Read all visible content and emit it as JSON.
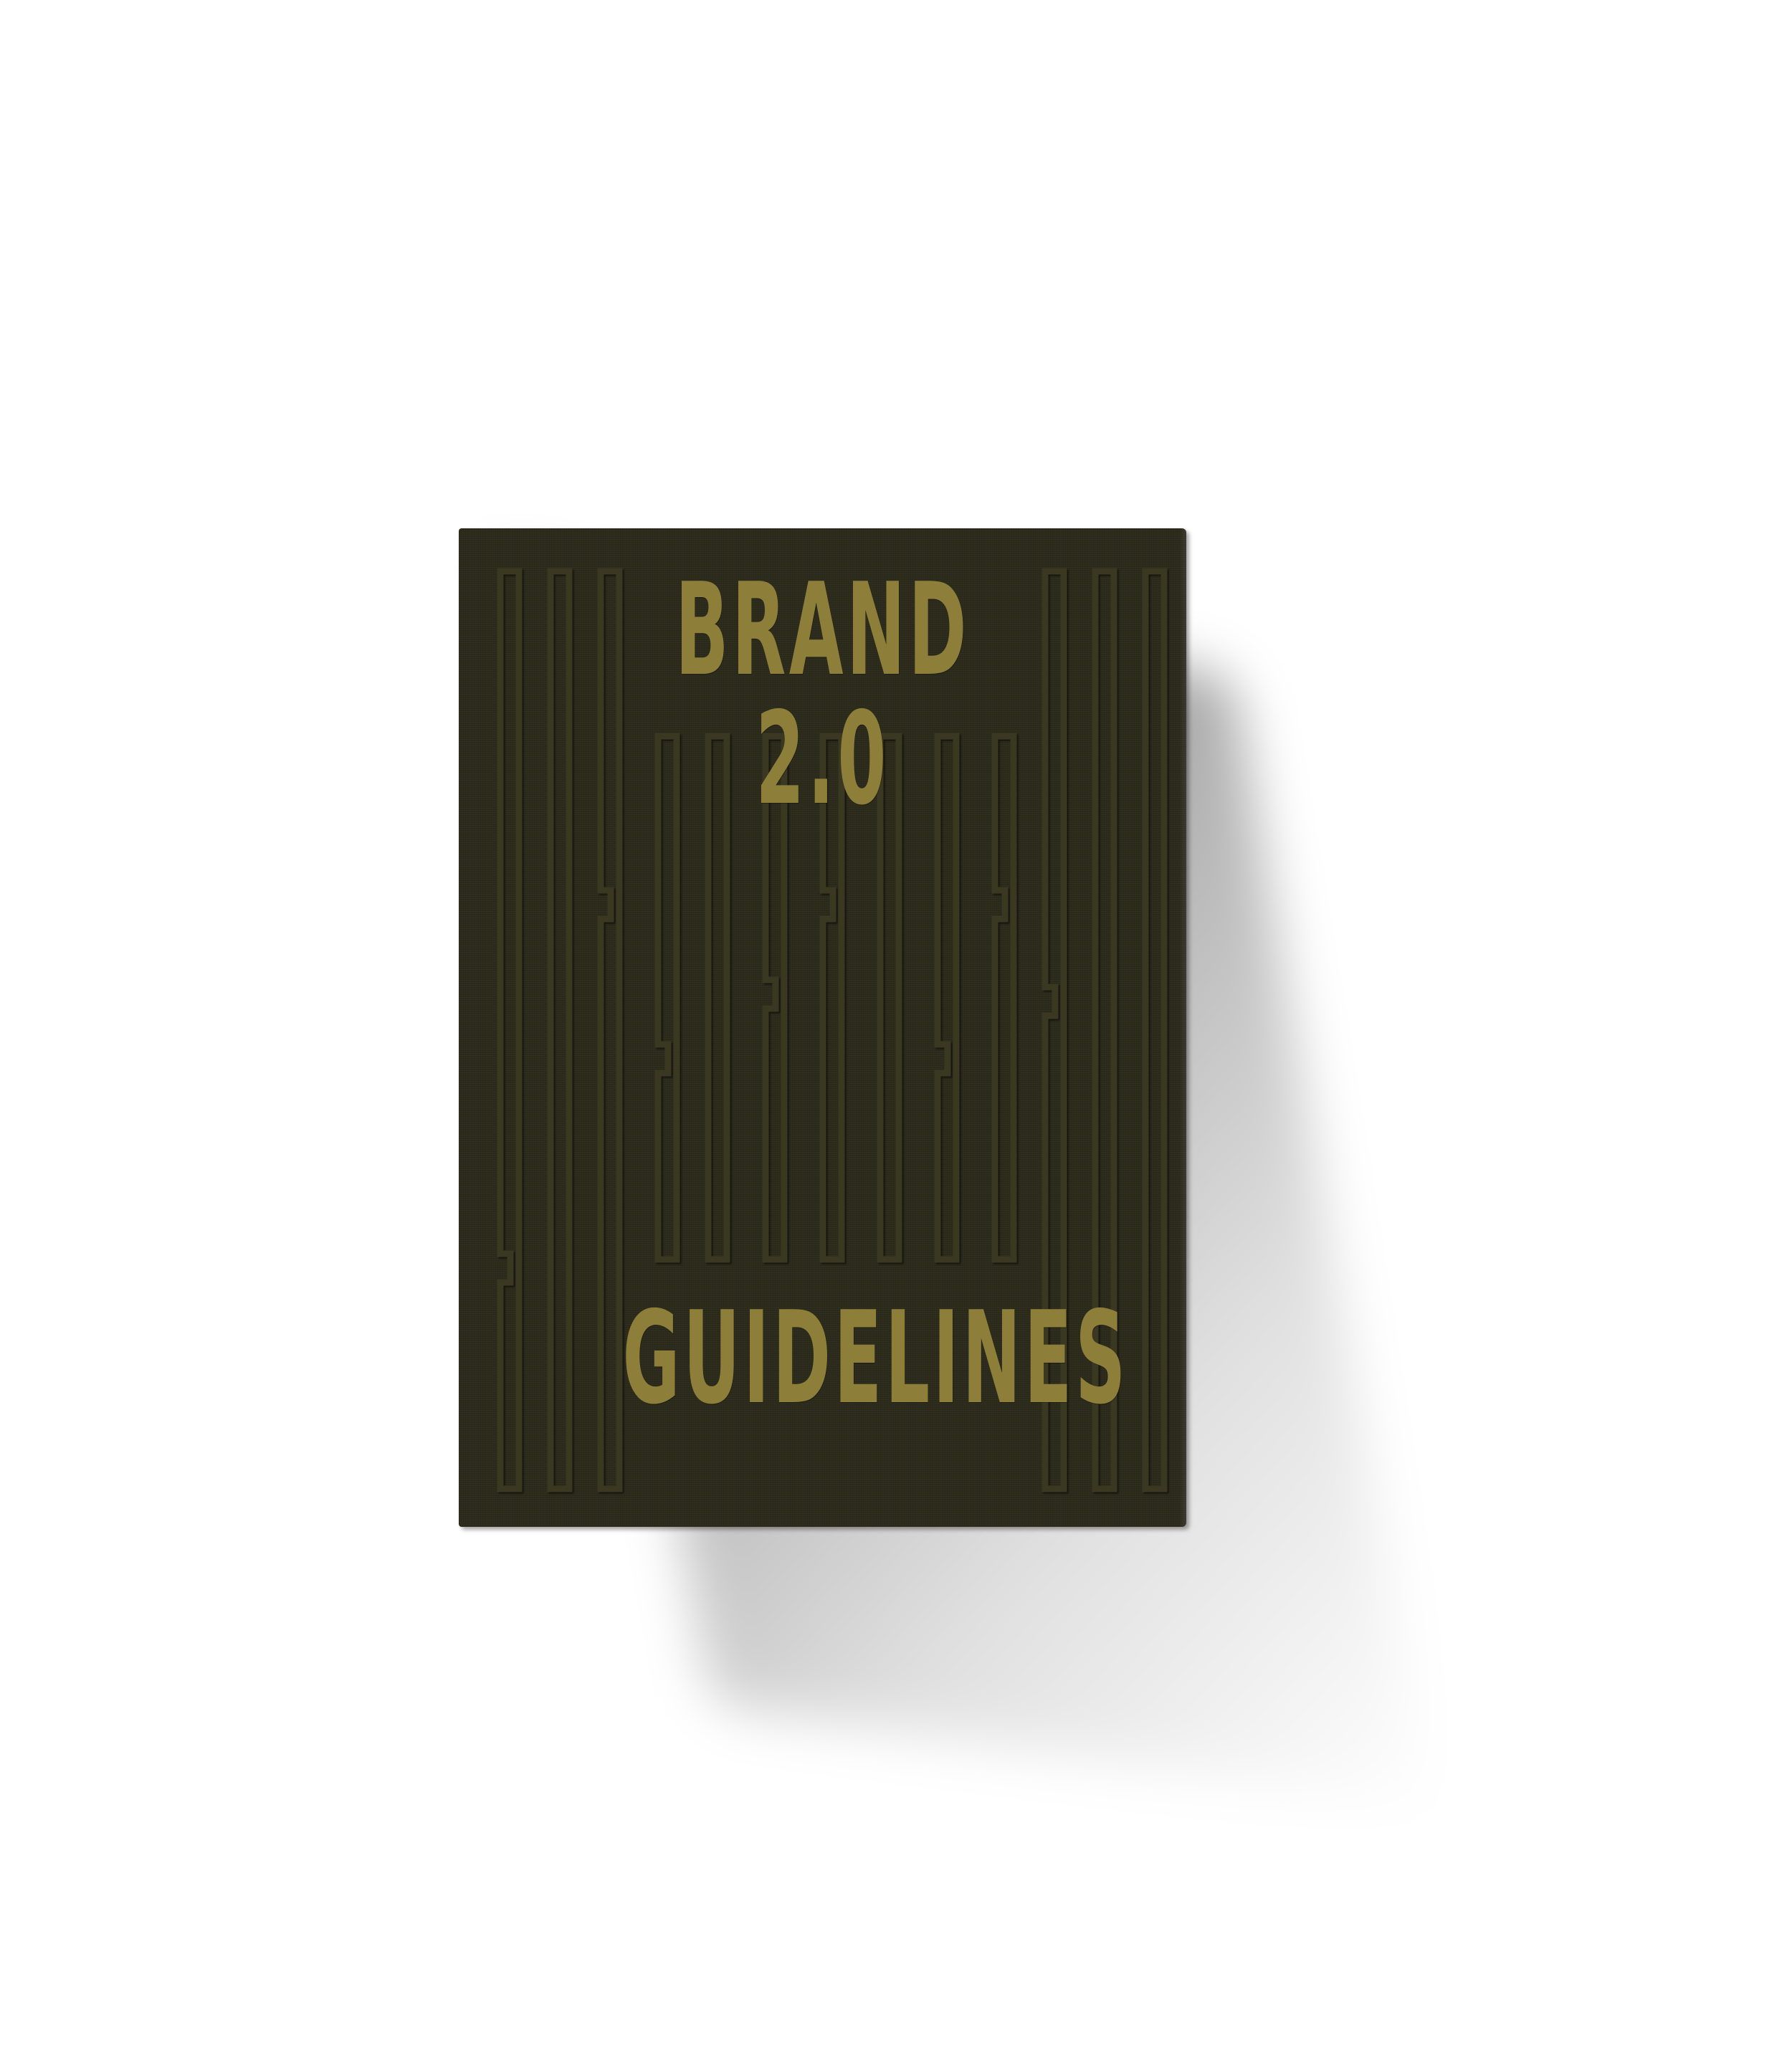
{
  "book": {
    "title_line1": "BRAND 2.0",
    "title_line2": "GUIDELINES",
    "cover_color": "#2b2a1b",
    "text_color": "#8d7f3a",
    "background_color": "#ffffff"
  }
}
